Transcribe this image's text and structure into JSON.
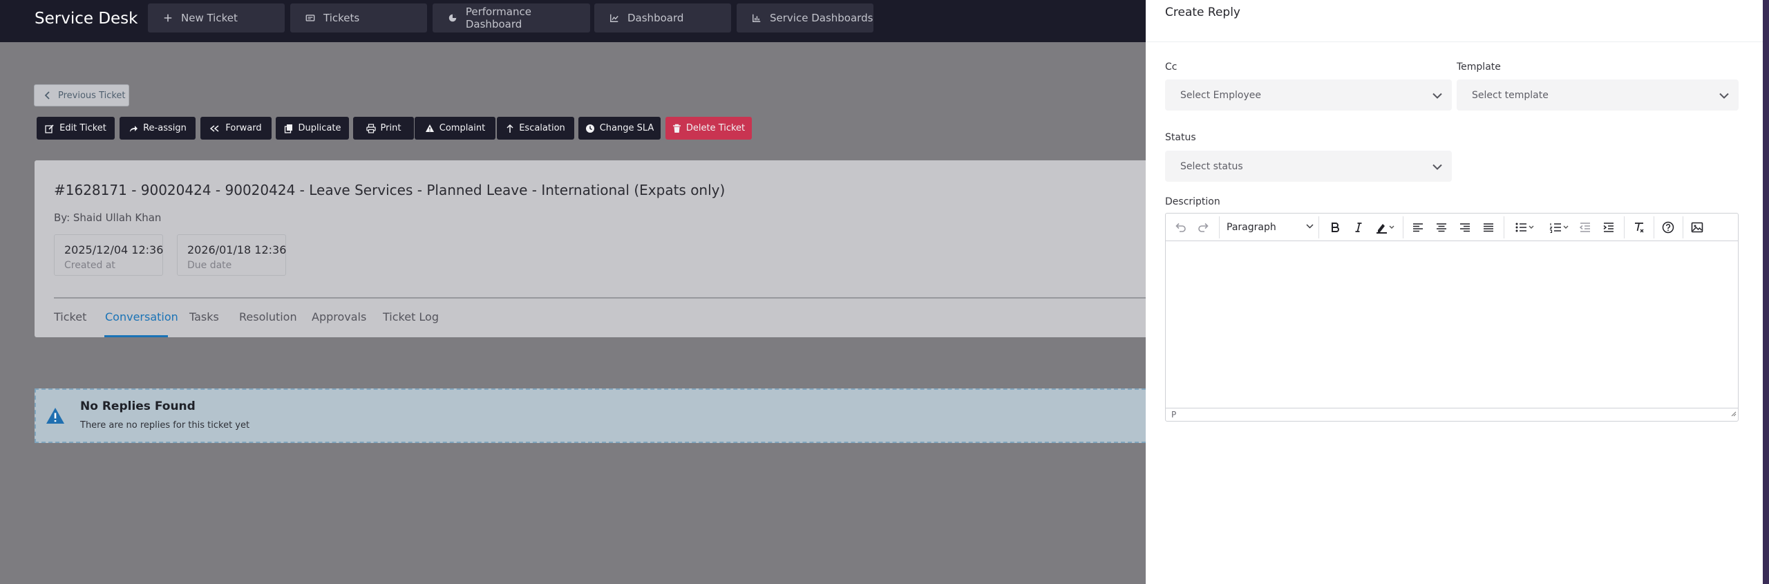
{
  "app": {
    "title": "Service Desk"
  },
  "nav": [
    {
      "label": "New Ticket",
      "icon": "plus-icon"
    },
    {
      "label": "Tickets",
      "icon": "ticket-icon"
    },
    {
      "label": "Performance Dashboard",
      "icon": "pie-chart-icon"
    },
    {
      "label": "Dashboard",
      "icon": "line-chart-icon"
    },
    {
      "label": "Service Dashboards",
      "icon": "bar-chart-icon"
    }
  ],
  "back_button": {
    "label": "Previous Ticket"
  },
  "toolbar": [
    {
      "label": "Edit Ticket",
      "icon": "edit-icon"
    },
    {
      "label": "Re-assign",
      "icon": "share-icon"
    },
    {
      "label": "Forward",
      "icon": "forward-icon"
    },
    {
      "label": "Duplicate",
      "icon": "copy-icon"
    },
    {
      "label": "Print",
      "icon": "printer-icon"
    },
    {
      "label": "Complaint",
      "icon": "warning-icon"
    },
    {
      "label": "Escalation",
      "icon": "arrow-up-icon"
    },
    {
      "label": "Change SLA",
      "icon": "clock-icon"
    },
    {
      "label": "Delete Ticket",
      "icon": "trash-icon"
    }
  ],
  "ticket": {
    "title": "#1628171 - 90020424 - 90020424 - Leave Services - Planned Leave - International (Expats only)",
    "by": "By: Shaid Ullah Khan",
    "created": {
      "value": "2025/12/04 12:36",
      "label": "Created at"
    },
    "due": {
      "value": "2026/01/18 12:36",
      "label": "Due date"
    }
  },
  "tabs": [
    "Ticket",
    "Conversation",
    "Tasks",
    "Resolution",
    "Approvals",
    "Ticket Log"
  ],
  "active_tab": "Conversation",
  "alert": {
    "title": "No Replies Found",
    "text": "There are no replies for this ticket yet"
  },
  "panel": {
    "title": "Create Reply",
    "cc": {
      "label": "Cc",
      "placeholder": "Select Employee"
    },
    "template": {
      "label": "Template",
      "placeholder": "Select template"
    },
    "status": {
      "label": "Status",
      "placeholder": "Select status"
    },
    "description": {
      "label": "Description"
    },
    "editor": {
      "block_format": "Paragraph",
      "path": "P",
      "tools": [
        "undo-icon",
        "redo-icon",
        "bold-icon",
        "italic-icon",
        "highlight-icon",
        "align-left-icon",
        "align-center-icon",
        "align-right-icon",
        "align-justify-icon",
        "bullet-list-icon",
        "numbered-list-icon",
        "outdent-icon",
        "indent-icon",
        "clear-format-icon",
        "help-icon",
        "image-icon"
      ]
    }
  },
  "colors": {
    "topbar": "#1b1b29",
    "nav_button": "#2f2f3e",
    "accent": "#1a73b6",
    "danger": "#c93451",
    "alert_bg": "#b4c3cd"
  }
}
